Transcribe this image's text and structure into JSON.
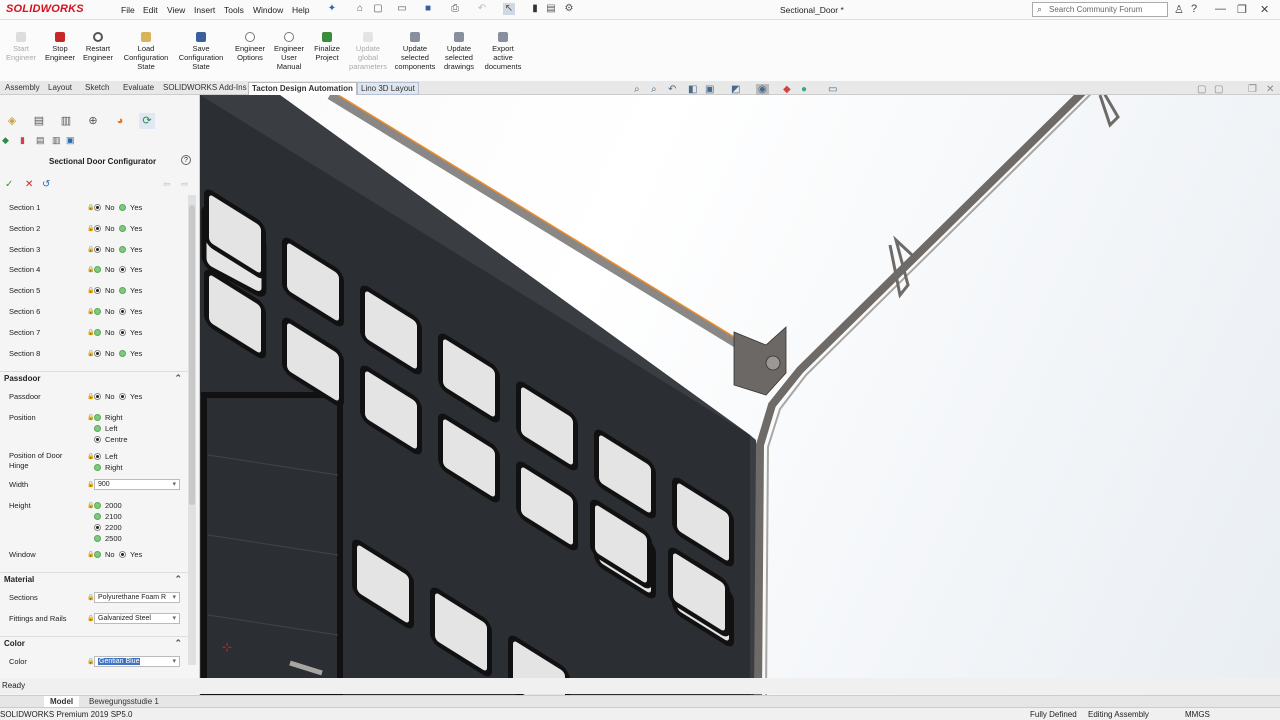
{
  "app": {
    "brand": "SOLIDWORKS",
    "doc_title": "Sectional_Door *"
  },
  "menu": [
    "File",
    "Edit",
    "View",
    "Insert",
    "Tools",
    "Window",
    "Help"
  ],
  "search": {
    "placeholder": "Search Community Forum"
  },
  "ribbon": {
    "start_engineer": "Start\nEngineer",
    "stop_engineer": "Stop\nEngineer",
    "restart_engineer": "Restart\nEngineer",
    "load_config": "Load\nConfiguration\nState",
    "save_config": "Save\nConfiguration\nState",
    "engineer_options": "Engineer\nOptions",
    "engineer_manual": "Engineer\nUser\nManual",
    "finalize_project": "Finalize\nProject",
    "update_global": "Update\nglobal\nparameters",
    "update_components": "Update\nselected\ncomponents",
    "update_drawings": "Update\nselected\ndrawings",
    "export_docs": "Export\nactive\ndocuments"
  },
  "tabs": [
    "Assembly",
    "Layout",
    "Sketch",
    "Evaluate",
    "SOLIDWORKS Add-Ins",
    "Tacton Design Automation",
    "Lino 3D Layout"
  ],
  "panel": {
    "title": "Sectional Door Configurator",
    "sections": [
      {
        "label": "Section 1",
        "value": "No"
      },
      {
        "label": "Section 2",
        "value": "No"
      },
      {
        "label": "Section 3",
        "value": "No"
      },
      {
        "label": "Section 4",
        "value": "Yes"
      },
      {
        "label": "Section 5",
        "value": "No"
      },
      {
        "label": "Section 6",
        "value": "Yes"
      },
      {
        "label": "Section 7",
        "value": "Yes"
      },
      {
        "label": "Section 8",
        "value": "No"
      }
    ],
    "opt_no": "No",
    "opt_yes": "Yes",
    "passdoor_header": "Passdoor",
    "passdoor_label": "Passdoor",
    "passdoor_value": "Yes",
    "position_label": "Position",
    "position_options": [
      "Right",
      "Left",
      "Centre"
    ],
    "position_selected": "Centre",
    "hinge_label": "Position of Door Hinge",
    "hinge_options": [
      "Left",
      "Right"
    ],
    "hinge_selected": "Left",
    "width_label": "Width",
    "width_value": "900",
    "height_label": "Height",
    "height_options": [
      "2000",
      "2100",
      "2200",
      "2500"
    ],
    "height_selected": "2200",
    "window_label": "Window",
    "window_value": "Yes",
    "material_header": "Material",
    "sections_label": "Sections",
    "sections_value": "Polyurethane Foam R",
    "fittings_label": "Fittings and Rails",
    "fittings_value": "Galvanized Steel",
    "color_header": "Color",
    "color_label": "Color",
    "color_value": "Gentian Blue"
  },
  "status": "Ready",
  "bottom_tabs": [
    "Model",
    "Bewegungsstudie 1"
  ],
  "footer": {
    "version": "SOLIDWORKS Premium 2019 SP5.0",
    "defined": "Fully Defined",
    "editing": "Editing Assembly",
    "units": "MMGS"
  },
  "colors": {
    "brand_red": "#d6111f",
    "door": "#2b2e33",
    "rail": "#6e6a67",
    "highlight": "#f08c2a"
  }
}
